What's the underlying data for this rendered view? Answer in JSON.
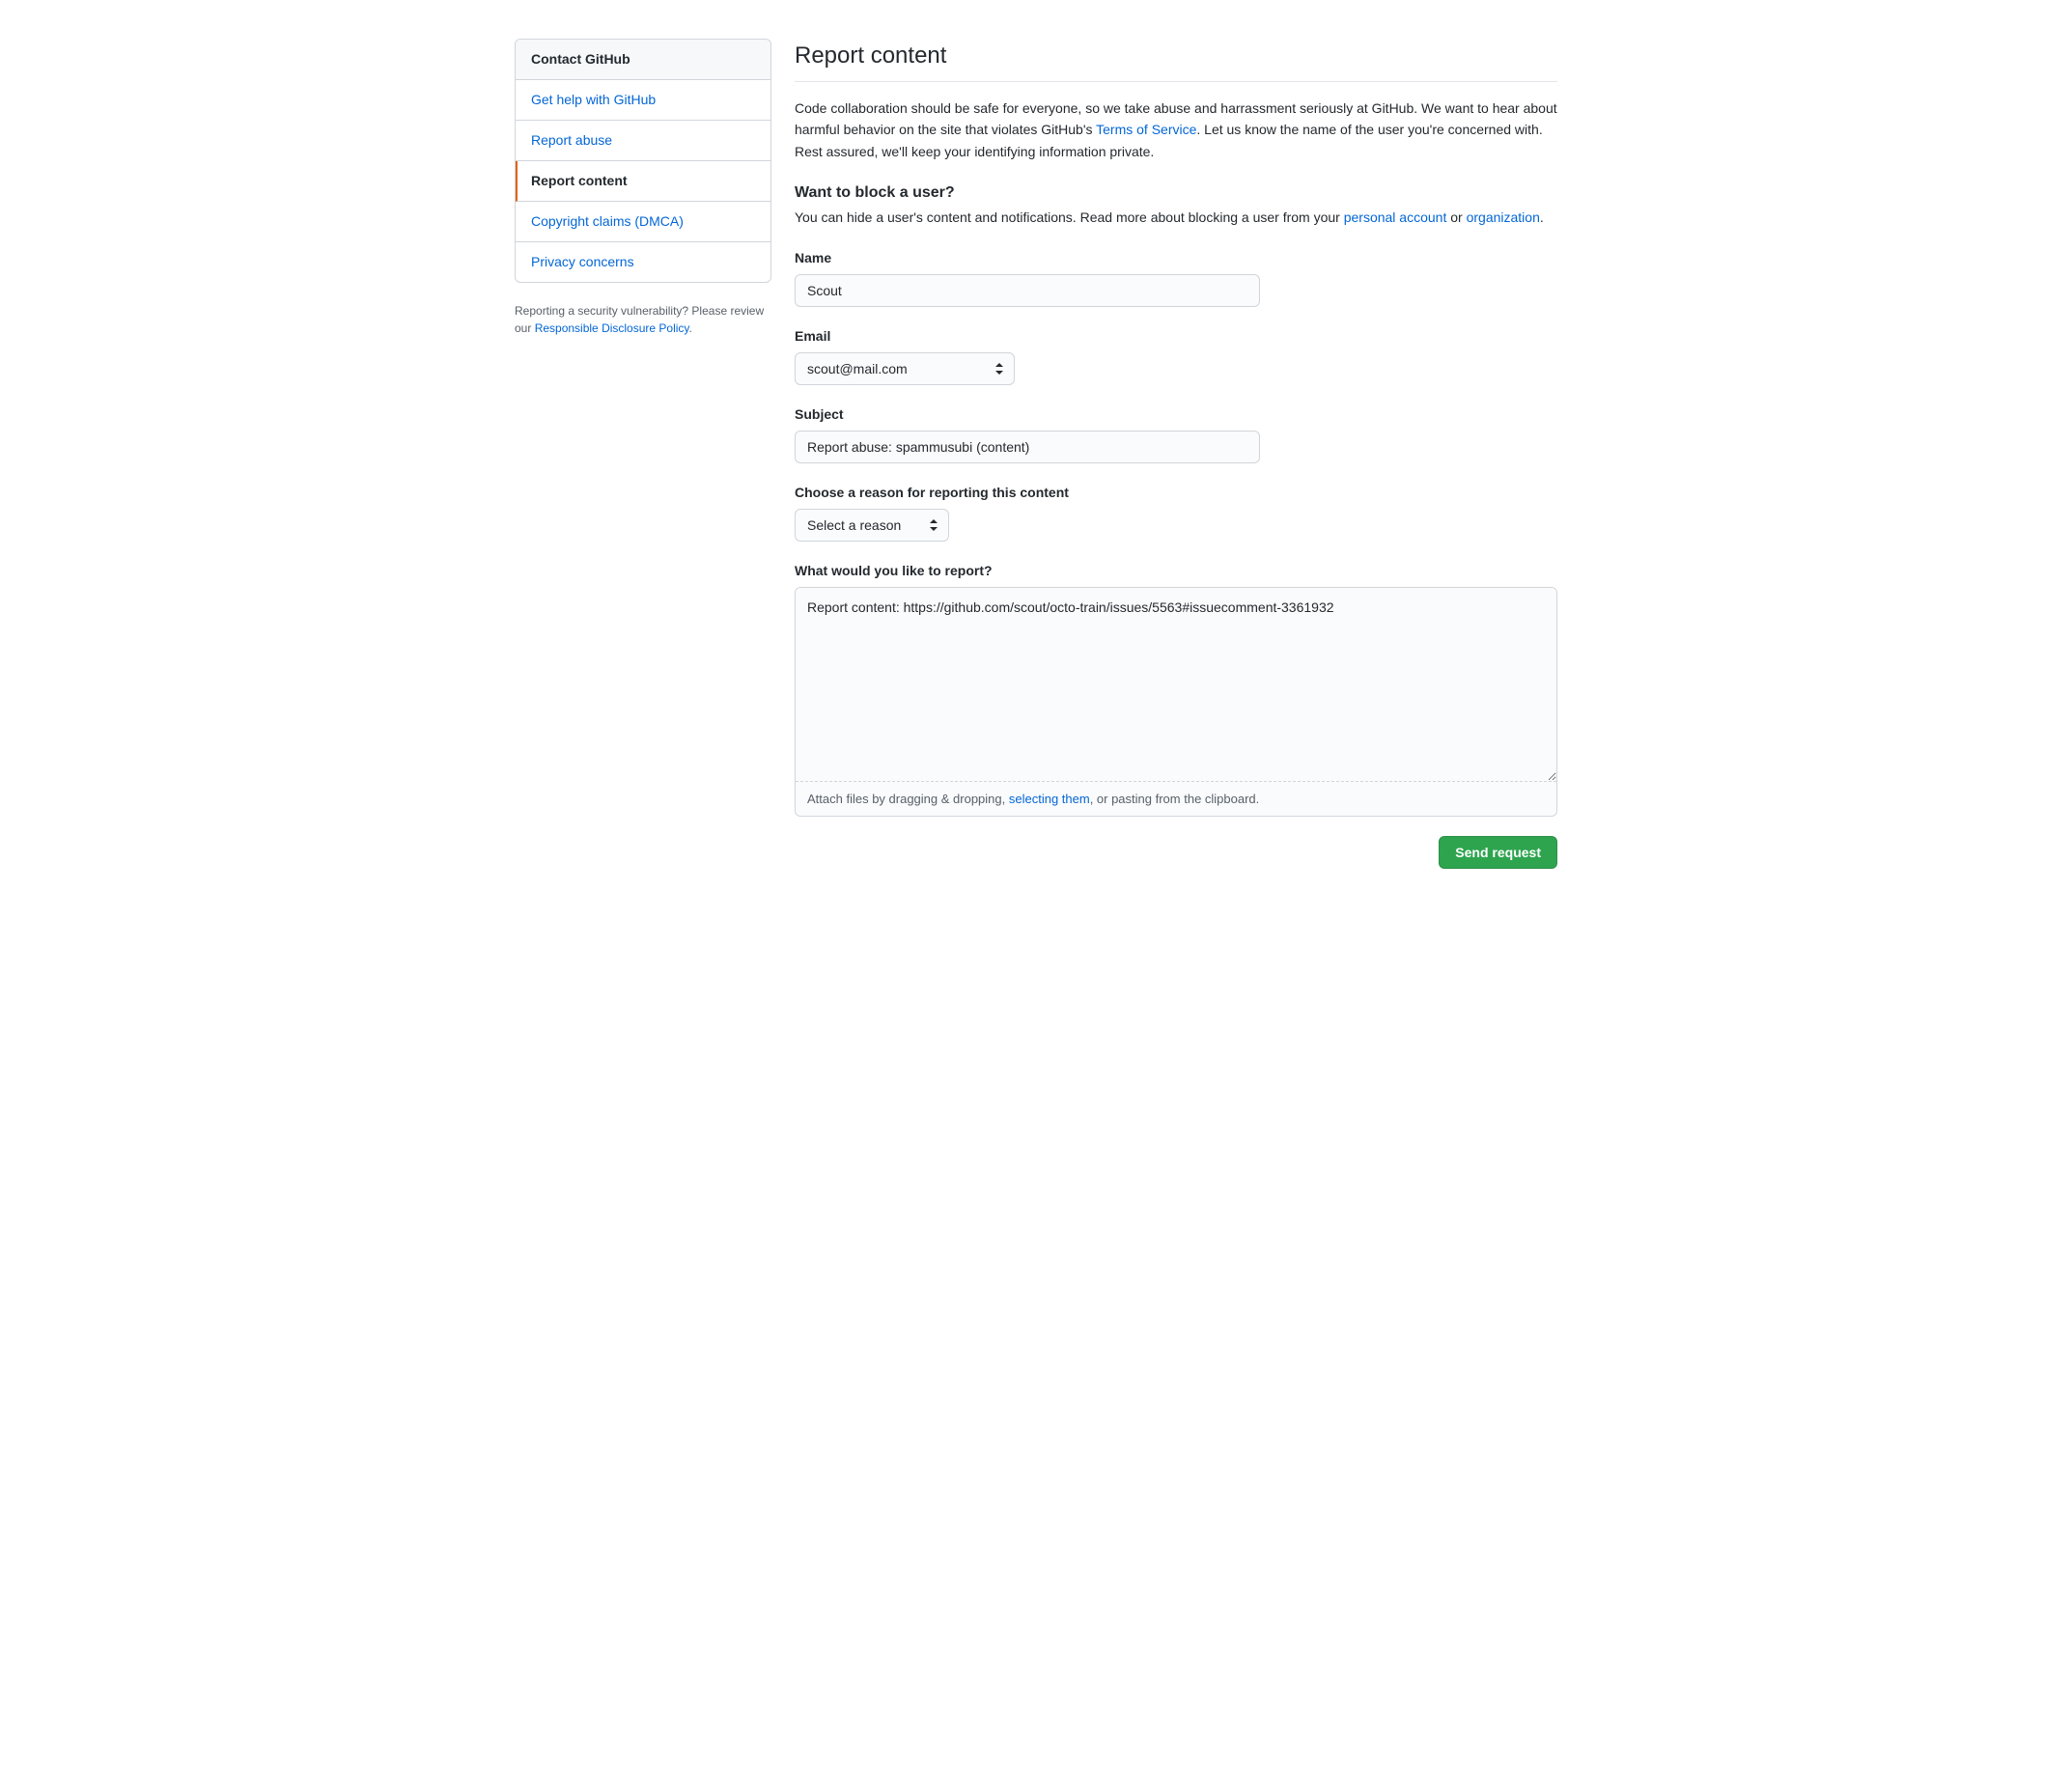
{
  "sidebar": {
    "header": "Contact GitHub",
    "items": [
      {
        "label": "Get help with GitHub",
        "active": false
      },
      {
        "label": "Report abuse",
        "active": false
      },
      {
        "label": "Report content",
        "active": true
      },
      {
        "label": "Copyright claims (DMCA)",
        "active": false
      },
      {
        "label": "Privacy concerns",
        "active": false
      }
    ],
    "note_prefix": "Reporting a security vulnerability? Please review our ",
    "note_link": "Responsible Disclosure Policy",
    "note_suffix": "."
  },
  "main": {
    "title": "Report content",
    "intro_1": "Code collaboration should be safe for everyone, so we take abuse and harrassment seriously at GitHub. We want to hear about harmful behavior on the site that violates GitHub's ",
    "intro_tos": "Terms of Service",
    "intro_2": ". Let us know the name of the user you're concerned with. Rest assured, we'll keep your identifying information private.",
    "block_heading": "Want to block a user?",
    "block_1": "You can hide a user's content and notifications. Read more about blocking a user from your ",
    "block_personal": "personal account",
    "block_or": " or ",
    "block_org": "organization",
    "block_suffix": "."
  },
  "form": {
    "name_label": "Name",
    "name_value": "Scout",
    "email_label": "Email",
    "email_value": "scout@mail.com",
    "subject_label": "Subject",
    "subject_value": "Report abuse: spammusubi (content)",
    "reason_label": "Choose a reason for reporting this content",
    "reason_value": "Select a reason",
    "body_label": "What would you like to report?",
    "body_value": "Report content: https://github.com/scout/octo-train/issues/5563#issuecomment-3361932",
    "attach_1": "Attach files by dragging & dropping, ",
    "attach_link": "selecting them",
    "attach_2": ", or pasting from the clipboard.",
    "submit": "Send request"
  }
}
